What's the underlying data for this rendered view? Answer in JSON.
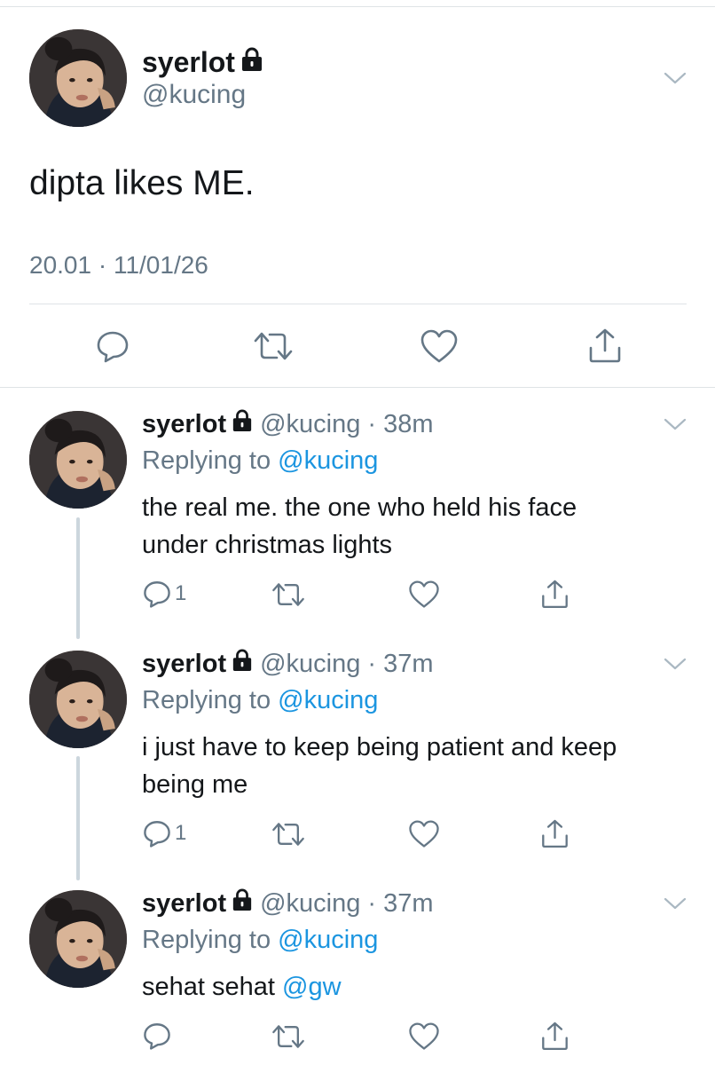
{
  "colors": {
    "accent": "#1b95e0",
    "secondary_text": "#657786",
    "divider": "#dfe3e6",
    "thread_line": "#ccd6dd"
  },
  "main_tweet": {
    "display_name": "syerlot",
    "handle": "@kucing",
    "text": "dipta likes ME.",
    "timestamp": "20.01 · 11/01/26",
    "icons": [
      "lock-icon",
      "chevron-down-icon",
      "reply-icon",
      "retweet-icon",
      "like-icon",
      "share-icon"
    ]
  },
  "replies": [
    {
      "display_name": "syerlot",
      "handle_time": "@kucing · 38m",
      "replying_prefix": "Replying to",
      "replying_to": "@kucing",
      "text_line1": "the real me. the one who held his face",
      "text_line2": "under christmas lights",
      "reply_count": "1"
    },
    {
      "display_name": "syerlot",
      "handle_time": "@kucing · 37m",
      "replying_prefix": "Replying to",
      "replying_to": "@kucing",
      "text_line1": "i just have to keep being patient and keep",
      "text_line2": "being me",
      "reply_count": "1"
    },
    {
      "display_name": "syerlot",
      "handle_time": "@kucing · 37m",
      "replying_prefix": "Replying to",
      "replying_to": "@kucing",
      "text_prefix": "sehat sehat ",
      "text_mention": "@gw",
      "reply_count": ""
    }
  ]
}
